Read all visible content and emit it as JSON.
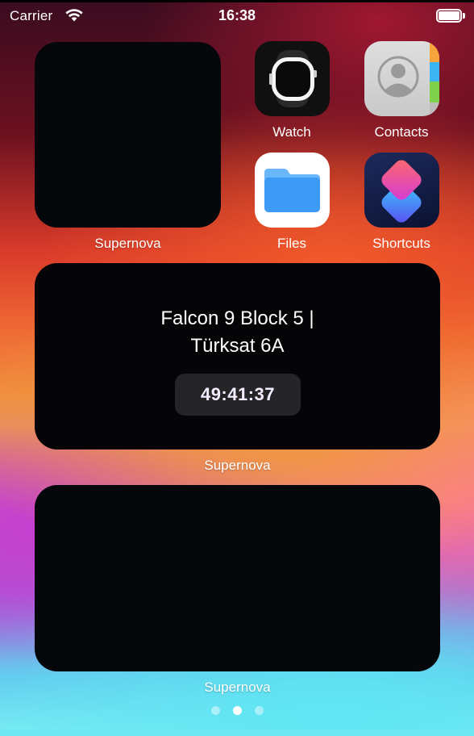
{
  "status_bar": {
    "carrier": "Carrier",
    "time": "16:38",
    "wifi_icon": "wifi-icon",
    "battery_icon": "battery-full-icon",
    "battery_level": 1.0
  },
  "widgets": {
    "small": {
      "label": "Supernova"
    },
    "medium": {
      "label": "Supernova",
      "title_line1": "Falcon 9 Block 5 |",
      "title_line2": "Türksat 6A",
      "countdown": "49:41:37"
    },
    "large": {
      "label": "Supernova"
    }
  },
  "apps": [
    {
      "name": "Watch",
      "icon": "watch-icon"
    },
    {
      "name": "Contacts",
      "icon": "contacts-icon"
    },
    {
      "name": "Files",
      "icon": "files-folder-icon"
    },
    {
      "name": "Shortcuts",
      "icon": "shortcuts-icon"
    }
  ],
  "page_indicator": {
    "page_count": 3,
    "current_page": 2
  },
  "colors": {
    "files_blue": "#3d9bf5",
    "shortcuts_pink": "#f04a8a",
    "shortcuts_blue": "#4aa0ff",
    "contacts_tabs": [
      "#f7a43a",
      "#3cb5f5",
      "#7fd04a"
    ]
  }
}
